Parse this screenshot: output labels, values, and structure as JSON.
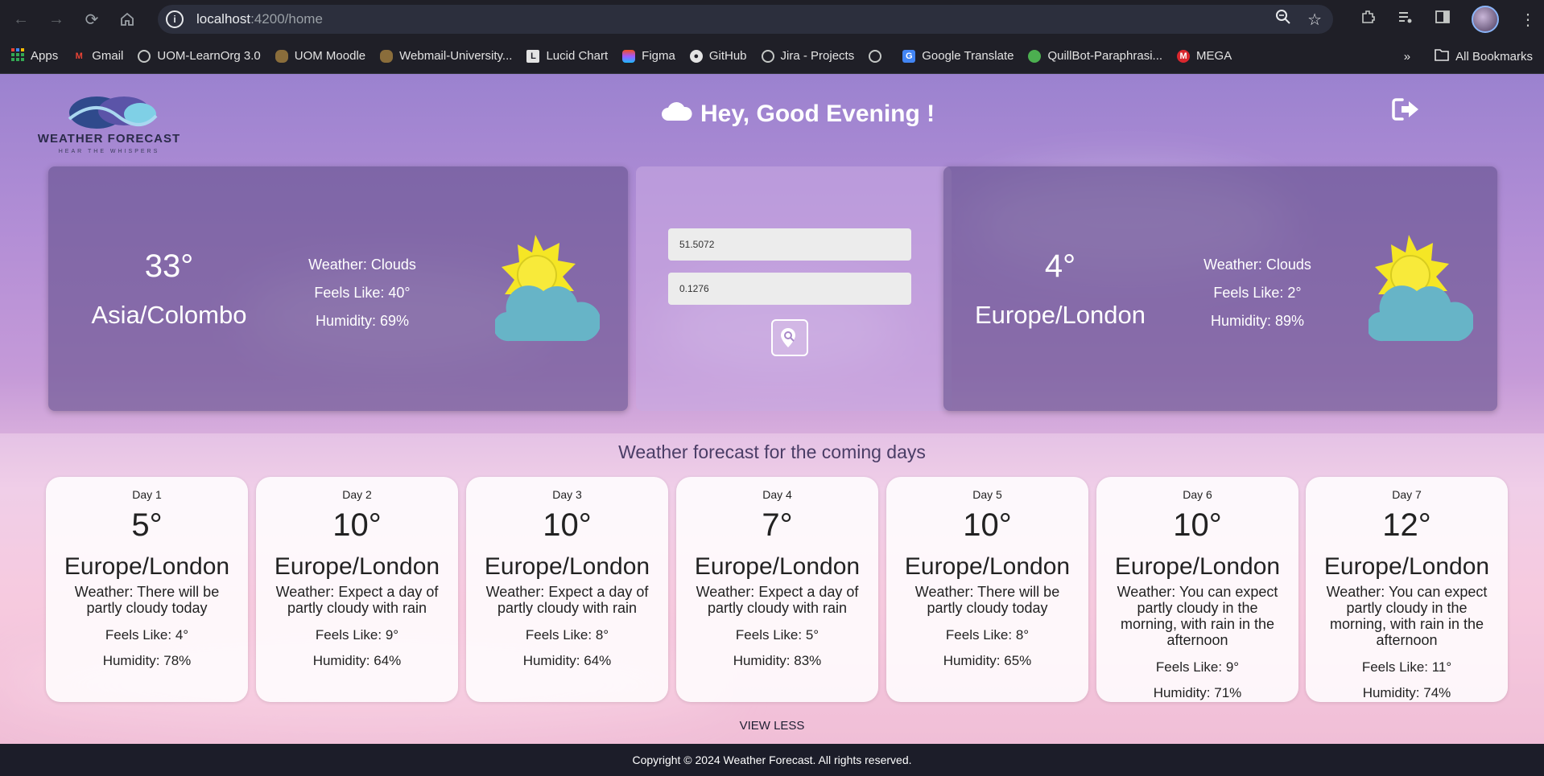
{
  "browser": {
    "url_host": "localhost",
    "url_path": ":4200/home",
    "bookmarks": [
      "Apps",
      "Gmail",
      "UOM-LearnOrg 3.0",
      "UOM Moodle",
      "Webmail-University...",
      "Lucid Chart",
      "Figma",
      "GitHub",
      "Jira - Projects",
      "",
      "Google Translate",
      "QuillBot-Paraphrasi...",
      "MEGA"
    ],
    "all_bookmarks": "All Bookmarks",
    "overflow": "»"
  },
  "header": {
    "logo_name": "WEATHER FORECAST",
    "logo_tagline": "HEAR THE WHISPERS",
    "greeting": "Hey, Good Evening !"
  },
  "current": [
    {
      "temp": "33°",
      "city": "Asia/Colombo",
      "weather": "Weather: Clouds",
      "feels": "Feels Like: 40°",
      "humidity": "Humidity: 69%"
    },
    {
      "temp": "4°",
      "city": "Europe/London",
      "weather": "Weather: Clouds",
      "feels": "Feels Like: 2°",
      "humidity": "Humidity: 89%"
    }
  ],
  "search": {
    "lat": "51.5072",
    "lon": "0.1276"
  },
  "forecast": {
    "title": "Weather forecast for the coming days",
    "days": [
      {
        "label": "Day 1",
        "temp": "5°",
        "city": "Europe/London",
        "desc": "Weather: There will be partly cloudy today",
        "feels": "Feels Like: 4°",
        "humidity": "Humidity: 78%"
      },
      {
        "label": "Day 2",
        "temp": "10°",
        "city": "Europe/London",
        "desc": "Weather: Expect a day of partly cloudy with rain",
        "feels": "Feels Like: 9°",
        "humidity": "Humidity: 64%"
      },
      {
        "label": "Day 3",
        "temp": "10°",
        "city": "Europe/London",
        "desc": "Weather: Expect a day of partly cloudy with rain",
        "feels": "Feels Like: 8°",
        "humidity": "Humidity: 64%"
      },
      {
        "label": "Day 4",
        "temp": "7°",
        "city": "Europe/London",
        "desc": "Weather: Expect a day of partly cloudy with rain",
        "feels": "Feels Like: 5°",
        "humidity": "Humidity: 83%"
      },
      {
        "label": "Day 5",
        "temp": "10°",
        "city": "Europe/London",
        "desc": "Weather: There will be partly cloudy today",
        "feels": "Feels Like: 8°",
        "humidity": "Humidity: 65%"
      },
      {
        "label": "Day 6",
        "temp": "10°",
        "city": "Europe/London",
        "desc": "Weather: You can expect partly cloudy in the morning, with rain in the afternoon",
        "feels": "Feels Like: 9°",
        "humidity": "Humidity: 71%"
      },
      {
        "label": "Day 7",
        "temp": "12°",
        "city": "Europe/London",
        "desc": "Weather: You can expect partly cloudy in the morning, with rain in the afternoon",
        "feels": "Feels Like: 11°",
        "humidity": "Humidity: 74%"
      }
    ],
    "view_less": "VIEW LESS"
  },
  "footer": {
    "copyright": "Copyright © 2024 Weather Forecast. All rights reserved."
  },
  "colors": {
    "page_top": "#9b82cf",
    "page_bottom": "#e9a7c6",
    "card": "#64508c",
    "footer": "#1c1d29",
    "sun": "#f5e625",
    "cloud": "#6bb5c9"
  }
}
